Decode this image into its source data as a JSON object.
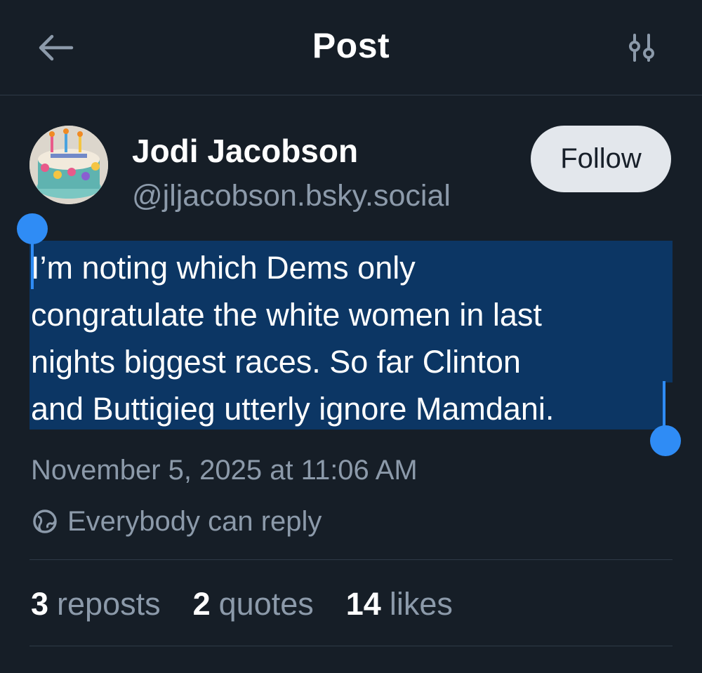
{
  "header": {
    "title": "Post",
    "back_icon": "arrow-left-icon",
    "filter_icon": "sliders-icon"
  },
  "author": {
    "name": "Jodi Jacobson",
    "handle": "@jljacobson.bsky.social",
    "follow_label": "Follow",
    "avatar_icon": "avatar-cake-image"
  },
  "post": {
    "lines": [
      "I’m noting which Dems only",
      "congratulate the white women in last",
      "nights biggest races. So far Clinton",
      "and Buttigieg utterly ignore Mamdani."
    ],
    "timestamp": "November 5, 2025 at 11:06 AM",
    "reply_setting": "Everybody can reply",
    "reply_icon": "globe-icon"
  },
  "stats": {
    "reposts_count": "3",
    "reposts_label": "reposts",
    "quotes_count": "2",
    "quotes_label": "quotes",
    "likes_count": "14",
    "likes_label": "likes"
  },
  "colors": {
    "background": "#161e27",
    "selection": "#0c3664",
    "selection_handle": "#2f8cf5",
    "muted_text": "#8c9aaa",
    "follow_button": "#e3e7ec"
  }
}
